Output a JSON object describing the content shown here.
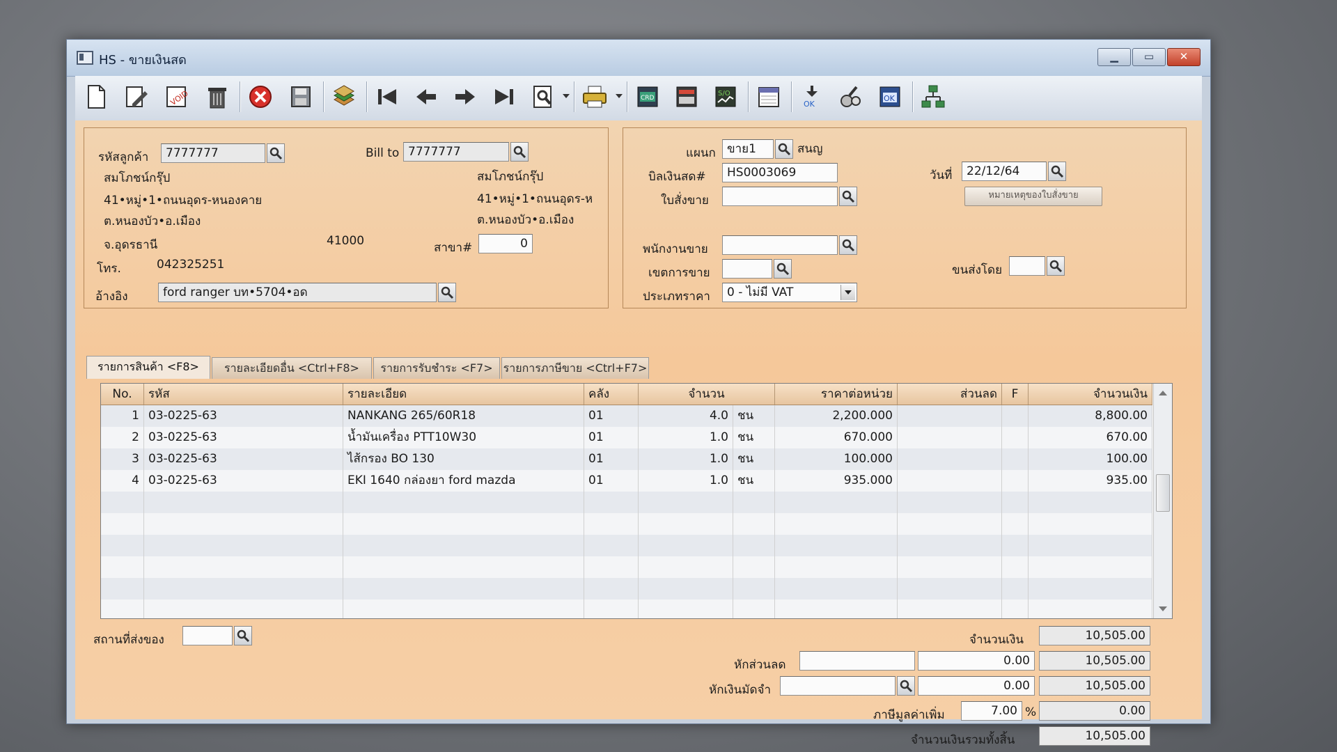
{
  "window": {
    "title": "HS - ขายเงินสด"
  },
  "titlebar_buttons": {
    "minimize": "▁",
    "maximize": "▭",
    "close": "✕"
  },
  "toolbar": [
    "new-doc-icon",
    "edit-icon",
    "void-icon",
    "delete-trash-icon",
    "cancel-icon",
    "save-icon",
    "copy-stack-icon",
    "first-record-icon",
    "previous-record-icon",
    "next-record-icon",
    "last-record-icon",
    "find-icon",
    "print-icon",
    "detail-icon",
    "report-icon",
    "so-icon",
    "calendar-icon",
    "approve-ok-icon",
    "audit-icon",
    "confirm-ok-icon",
    "network-icon"
  ],
  "customer": {
    "code_label": "รหัสลูกค้า",
    "code": "7777777",
    "name": "สมโภชน์กรุ๊ป",
    "address1": "41•หมู่•1•ถนนอุดร-หนองคาย",
    "address2": "ต.หนองบัว•อ.เมือง",
    "province": "จ.อุดรธานี",
    "postcode": "41000",
    "phone_label": "โทร.",
    "phone": "042325251",
    "ref_label": "อ้างอิง",
    "ref": "ford ranger บท•5704•อด"
  },
  "bill_to": {
    "label": "Bill to",
    "code": "7777777",
    "name": "สมโภชน์กรุ๊ป",
    "address1": "41•หมู่•1•ถนนอุดร-ห",
    "address2": "ต.หนองบัว•อ.เมือง",
    "branch_label": "สาขา#",
    "branch": "0"
  },
  "doc": {
    "dept_label": "แผนก",
    "dept": "ขาย1",
    "dept_name": "สนญ",
    "bill_label": "บิลเงินสด#",
    "bill_no": "HS0003069",
    "date_label": "วันที่",
    "date": "22/12/64",
    "order_label": "ใบสั่งขาย",
    "order": "",
    "order_note_button": "หมายเหตุของใบสั่งขาย",
    "salesman_label": "พนักงานขาย",
    "salesman": "",
    "zone_label": "เขตการขาย",
    "zone": "",
    "ship_label": "ขนส่งโดย",
    "ship": "",
    "pricetype_label": "ประเภทราคา",
    "pricetype": "0 - ไม่มี VAT"
  },
  "tabs": [
    {
      "label": "รายการสินค้า <F8>"
    },
    {
      "label": "รายละเอียดอื่น <Ctrl+F8>"
    },
    {
      "label": "รายการรับชำระ <F7>"
    },
    {
      "label": "รายการภาษีขาย <Ctrl+F7>"
    }
  ],
  "grid": {
    "headers": {
      "no": "No.",
      "code": "รหัส",
      "desc": "รายละเอียด",
      "wh": "คลัง",
      "qty": "จำนวน",
      "price": "ราคาต่อหน่วย",
      "disc": "ส่วนลด",
      "f": "F",
      "amount": "จำนวนเงิน"
    },
    "rows": [
      {
        "no": "1",
        "code": "03-0225-63",
        "desc": "NANKANG 265/60R18",
        "wh": "01",
        "qty": "4.0",
        "unit": "ชน",
        "price": "2,200.000",
        "disc": "",
        "f": "",
        "amount": "8,800.00"
      },
      {
        "no": "2",
        "code": "03-0225-63",
        "desc": "น้ำมันเครื่อง PTT10W30",
        "wh": "01",
        "qty": "1.0",
        "unit": "ชน",
        "price": "670.000",
        "disc": "",
        "f": "",
        "amount": "670.00"
      },
      {
        "no": "3",
        "code": "03-0225-63",
        "desc": "ไส้กรอง BO 130",
        "wh": "01",
        "qty": "1.0",
        "unit": "ชน",
        "price": "100.000",
        "disc": "",
        "f": "",
        "amount": "100.00"
      },
      {
        "no": "4",
        "code": "03-0225-63",
        "desc": "EKI 1640 กล่องยา ford mazda",
        "wh": "01",
        "qty": "1.0",
        "unit": "ชน",
        "price": "935.000",
        "disc": "",
        "f": "",
        "amount": "935.00"
      }
    ]
  },
  "footer": {
    "delivery_label": "สถานที่ส่งของ",
    "delivery": "",
    "amount_label": "จำนวนเงิน",
    "amount": "10,505.00",
    "discount_label": "หักส่วนลด",
    "discount_code": "",
    "discount": "0.00",
    "after_discount": "10,505.00",
    "deposit_label": "หักเงินมัดจำ",
    "deposit_code": "",
    "deposit": "0.00",
    "after_deposit": "10,505.00",
    "vat_label": "ภาษีมูลค่าเพิ่ม",
    "vat_rate": "7.00",
    "vat_pct": "%",
    "vat": "0.00",
    "total_label": "จำนวนเงินรวมทั้งสิ้น",
    "total": "10,505.00"
  }
}
